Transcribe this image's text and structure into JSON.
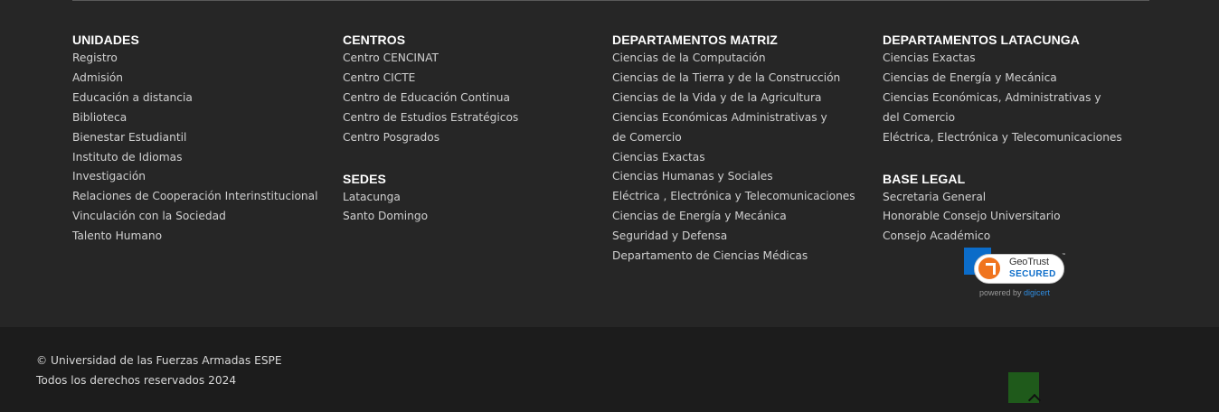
{
  "columns": [
    {
      "sections": [
        {
          "heading": "UNIDADES",
          "items": [
            "Registro",
            "Admisión",
            "Educación a distancia",
            "Biblioteca",
            "Bienestar Estudiantil",
            "Instituto de Idiomas",
            "Investigación",
            "Relaciones de Cooperación Interinstitucional",
            "Vinculación con la Sociedad",
            "Talento Humano"
          ]
        }
      ]
    },
    {
      "sections": [
        {
          "heading": "CENTROS",
          "items": [
            "Centro CENCINAT",
            "Centro CICTE",
            "Centro de Educación Continua",
            "Centro de Estudios Estratégicos",
            "Centro Posgrados"
          ]
        },
        {
          "heading": "SEDES",
          "items": [
            "Latacunga",
            "Santo Domingo"
          ]
        }
      ]
    },
    {
      "sections": [
        {
          "heading": "DEPARTAMENTOS MATRIZ",
          "items": [
            "Ciencias de la Computación",
            "Ciencias de la Tierra y de la Construcción",
            "Ciencias de la Vida y de la Agricultura",
            "Ciencias Económicas Administrativas y de Comercio",
            "Ciencias Exactas",
            "Ciencias Humanas y Sociales",
            "Eléctrica , Electrónica y Telecomunicaciones",
            "Ciencias de Energía y Mecánica",
            "Seguridad y Defensa",
            "Departamento de Ciencias Médicas"
          ]
        }
      ]
    },
    {
      "sections": [
        {
          "heading": "DEPARTAMENTOS LATACUNGA",
          "items": [
            "Ciencias Exactas",
            "Ciencias de Energía y Mecánica",
            "Ciencias Económicas, Administrativas y del Comercio",
            "Eléctrica, Electrónica y Telecomunicaciones"
          ]
        },
        {
          "heading": "BASE LEGAL",
          "items": [
            "Secretaria General",
            "Honorable Consejo Universitario",
            "Consejo Académico"
          ]
        }
      ]
    }
  ],
  "badge": {
    "brand": "GeoTrust",
    "secured": "SECURED",
    "tm": "™",
    "powered_by": "powered by",
    "provider": "digicert",
    "icon": "geotrust-logo-icon"
  },
  "bottom": {
    "copyright": "© Universidad de las Fuerzas Armadas ESPE",
    "rights": "Todos los derechos reservados 2024",
    "back_to_top_icon": "chevron-up-icon"
  },
  "colors": {
    "main_bg": "#262626",
    "bottom_bg": "#1c1c1c",
    "heading": "#ffffff",
    "link": "#d0d0d0",
    "back_to_top": "#1f5a1b"
  }
}
